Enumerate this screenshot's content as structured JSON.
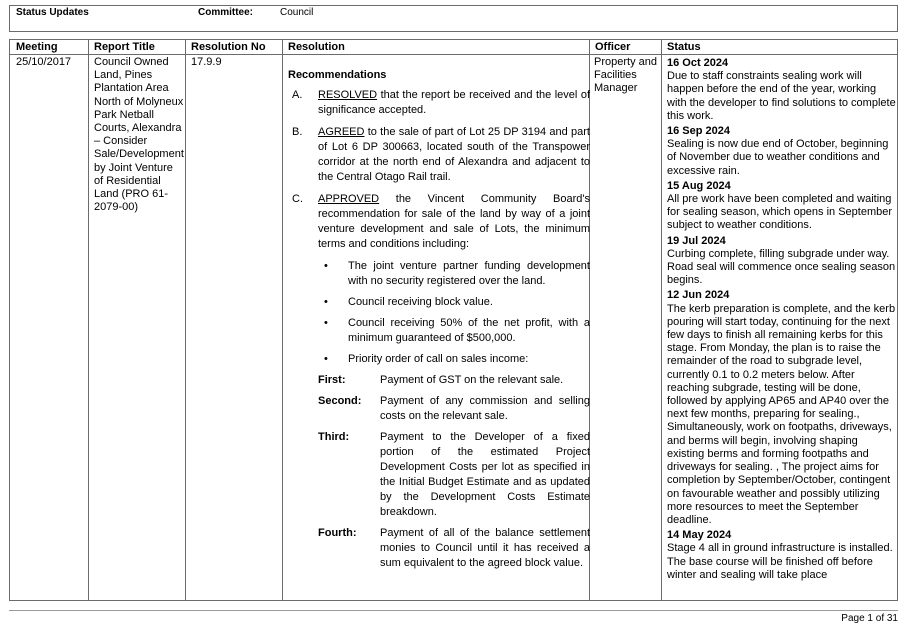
{
  "header": {
    "status_label": "Status Updates",
    "committee_label": "Committee:",
    "committee_value": "Council"
  },
  "columns": {
    "meeting": "Meeting",
    "title": "Report Title",
    "resno": "Resolution No",
    "resolution": "Resolution",
    "officer": "Officer",
    "status": "Status"
  },
  "row": {
    "meeting": "25/10/2017",
    "title": "Council Owned Land, Pines Plantation Area North of Molyneux Park Netball Courts, Alexandra – Consider Sale/Development by Joint Venture of Residential Land (PRO 61-2079-00)",
    "resno": "17.9.9",
    "officer": "Property and Facilities Manager",
    "resolution": {
      "title": "Recommendations",
      "a": {
        "letter": "A.",
        "kw": "RESOLVED",
        "text": " that the report be received and the level of significance accepted."
      },
      "b": {
        "letter": "B.",
        "kw": "AGREED",
        "text": " to the sale of part of Lot 25 DP 3194 and part of Lot 6 DP 300663, located south of the Transpower corridor at the north end of Alexandra and adjacent to the Central Otago Rail trail."
      },
      "c": {
        "letter": "C.",
        "kw": "APPROVED",
        "text": " the Vincent Community Board's recommendation for sale of the land by way of a joint venture development and sale of Lots, the minimum terms and conditions including:"
      },
      "bullets": [
        "The joint venture partner funding development with no security registered over the land.",
        "Council receiving block value.",
        "Council receiving 50% of the net profit, with a minimum guaranteed of $500,000.",
        "Priority order of call on sales income:"
      ],
      "bullet_char": "•",
      "order": [
        {
          "label": "First:",
          "text": "Payment of GST on the relevant sale."
        },
        {
          "label": "Second:",
          "text": "Payment of any commission and selling costs on the relevant sale."
        },
        {
          "label": "Third:",
          "text": "Payment to the Developer of a fixed portion of the estimated Project Development Costs per lot as specified in the Initial Budget Estimate and as updated by the Development Costs Estimate breakdown."
        },
        {
          "label": "Fourth:",
          "text": "Payment of all of the balance settlement monies to Council until it has received a sum equivalent to the agreed block value."
        }
      ]
    },
    "status": [
      {
        "date": "16 Oct 2024",
        "text": "Due to staff constraints sealing work will happen before the end of the year, working with the developer to find solutions to complete this work."
      },
      {
        "date": "16 Sep 2024",
        "text": "Sealing is now due end of October, beginning of November due to weather conditions and excessive rain."
      },
      {
        "date": "15 Aug 2024",
        "text": "All pre work have been completed and waiting for sealing season, which opens in September subject to weather conditions."
      },
      {
        "date": "19 Jul 2024",
        "text": "Curbing complete, filling subgrade under way. Road seal will commence once sealing season begins."
      },
      {
        "date": "12 Jun 2024",
        "text": "The kerb preparation is complete, and the kerb pouring will start today, continuing for the next few days to finish all remaining kerbs for this stage. From Monday, the plan is to raise the remainder of the road to subgrade level, currently 0.1 to 0.2 meters below. After reaching subgrade, testing will be done, followed by applying AP65 and AP40 over the next few months, preparing for sealing., Simultaneously, work on footpaths, driveways, and berms will begin, involving shaping existing berms and forming footpaths and driveways for sealing. , The project aims for completion by September/October, contingent on favourable weather and possibly utilizing more resources to meet the September deadline."
      },
      {
        "date": "14 May 2024",
        "text": "Stage 4 all in ground infrastructure is installed. The base course will be finished off before winter and sealing will take place"
      }
    ]
  },
  "footer": {
    "page": "Page 1 of 31"
  }
}
